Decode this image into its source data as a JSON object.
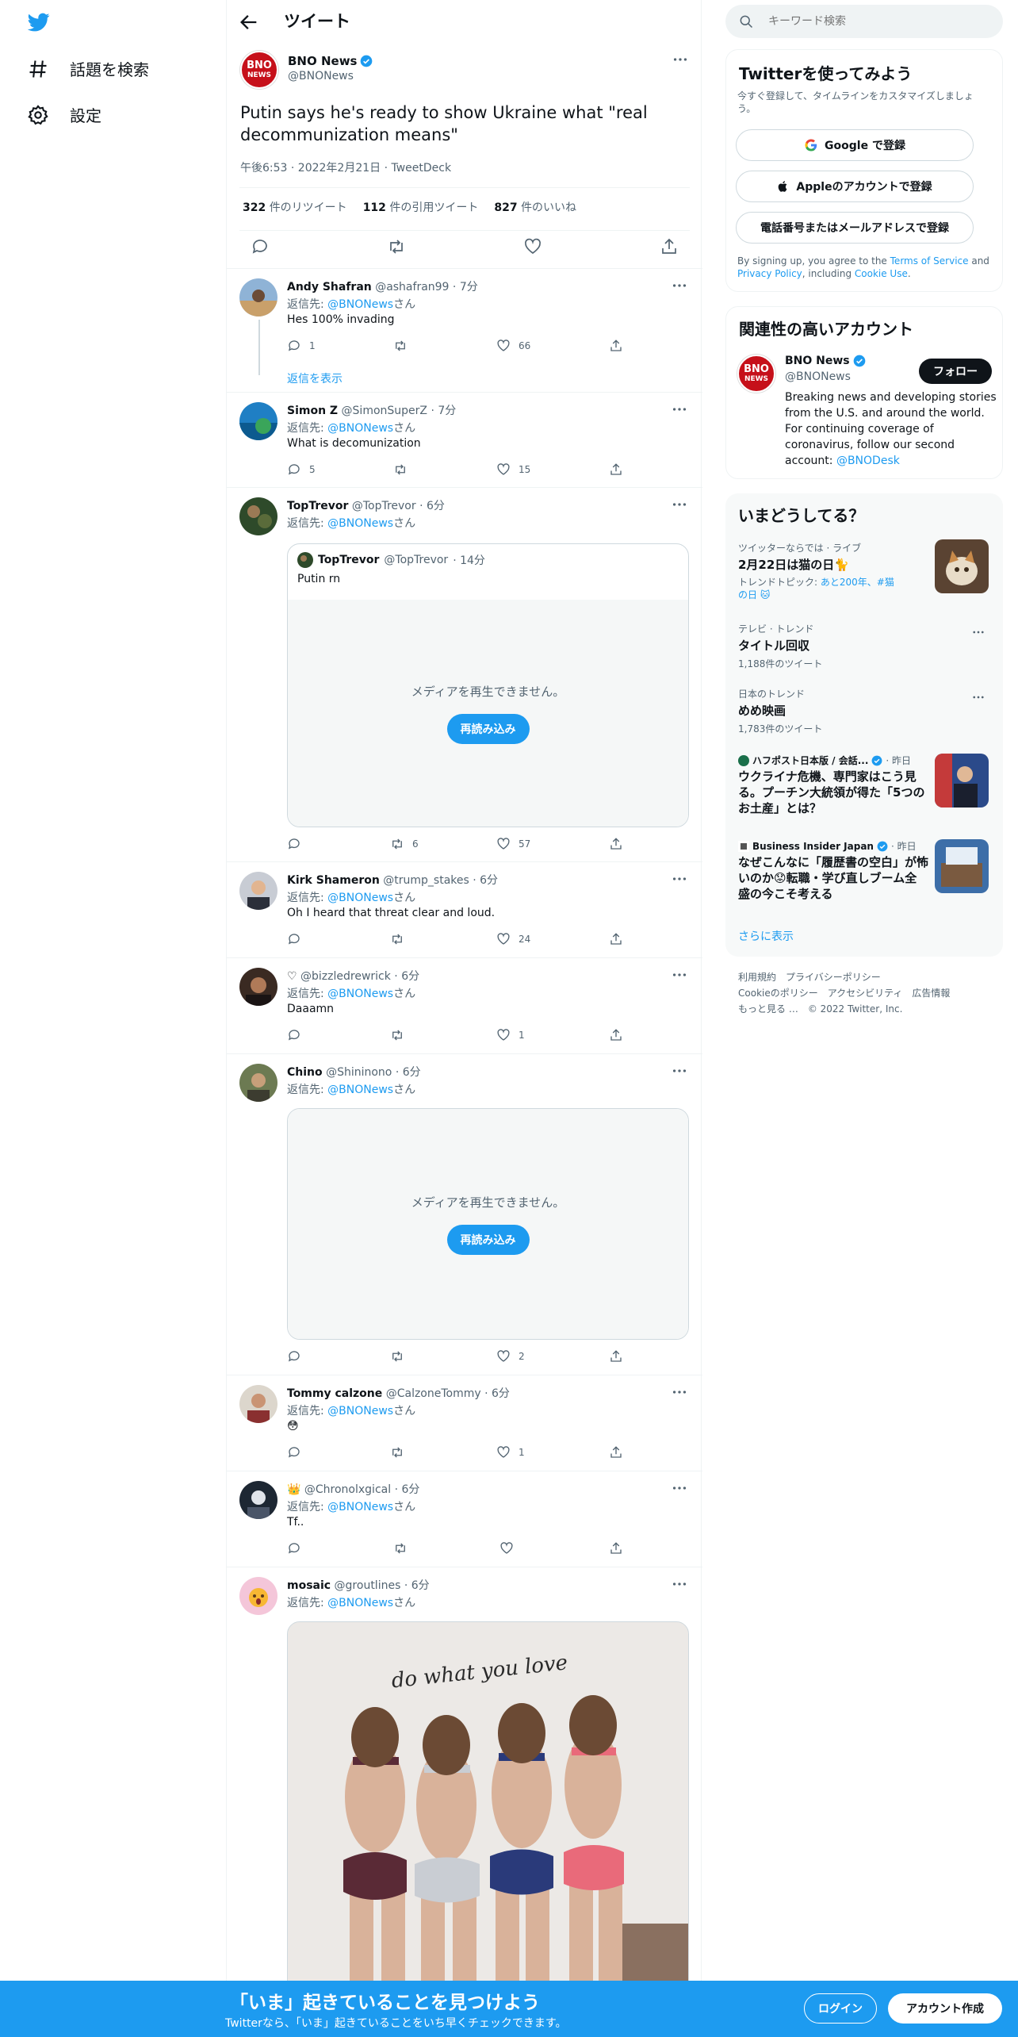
{
  "nav": {
    "explore_label": "話題を検索",
    "settings_label": "設定"
  },
  "header": {
    "title": "ツイート"
  },
  "main_tweet": {
    "name": "BNO News",
    "handle": "@BNONews",
    "avatar_text_top": "BNO",
    "avatar_text_bottom": "NEWS",
    "text": "Putin says he's ready to show Ukraine what \"real decommunization means\"",
    "meta": "午後6:53 · 2022年2月21日 · TweetDeck",
    "retweets_count": "322",
    "retweets_label": "件のリツイート",
    "quotes_count": "112",
    "quotes_label": "件の引用ツイート",
    "likes_count": "827",
    "likes_label": "件のいいね"
  },
  "replies": [
    {
      "name": "Andy Shafran",
      "handle": "@ashafran99",
      "time": "· 7分",
      "to_prefix": "返信先: ",
      "to_link": "@BNONews",
      "to_suffix": "さん",
      "text": "Hes 100% invading",
      "reply_count": "1",
      "retweet_count": "",
      "like_count": "66",
      "show_replies": "返信を表示"
    },
    {
      "name": "Simon Z",
      "handle": "@SimonSuperZ",
      "time": "· 7分",
      "to_prefix": "返信先: ",
      "to_link": "@BNONews",
      "to_suffix": "さん",
      "text": "What is decomunization",
      "reply_count": "5",
      "retweet_count": "",
      "like_count": "15"
    },
    {
      "name": "TopTrevor",
      "handle": "@TopTrevor",
      "time": "· 6分",
      "to_prefix": "返信先: ",
      "to_link": "@BNONews",
      "to_suffix": "さん",
      "quoted_name": "TopTrevor",
      "quoted_handle": "@TopTrevor",
      "quoted_time": "· 14分",
      "quoted_text": "Putin rn",
      "media_msg": "メディアを再生できません。",
      "reload": "再読み込み",
      "reply_count": "",
      "retweet_count": "6",
      "like_count": "57"
    },
    {
      "name": "Kirk Shameron",
      "handle": "@trump_stakes",
      "time": "· 6分",
      "to_prefix": "返信先: ",
      "to_link": "@BNONews",
      "to_suffix": "さん",
      "text": "Oh I heard that threat clear and loud.",
      "reply_count": "",
      "retweet_count": "",
      "like_count": "24"
    },
    {
      "name": "♡",
      "handle": "@bizzledrewrick",
      "time": "· 6分",
      "to_prefix": "返信先: ",
      "to_link": "@BNONews",
      "to_suffix": "さん",
      "text": "Daaamn",
      "reply_count": "",
      "retweet_count": "",
      "like_count": "1"
    },
    {
      "name": "Chino",
      "handle": "@Shininono",
      "time": "· 6分",
      "to_prefix": "返信先: ",
      "to_link": "@BNONews",
      "to_suffix": "さん",
      "media_msg": "メディアを再生できません。",
      "reload": "再読み込み",
      "reply_count": "",
      "retweet_count": "",
      "like_count": "2"
    },
    {
      "name": "Tommy calzone",
      "handle": "@CalzoneTommy",
      "time": "· 6分",
      "to_prefix": "返信先: ",
      "to_link": "@BNONews",
      "to_suffix": "さん",
      "text": "😳",
      "reply_count": "",
      "retweet_count": "",
      "like_count": "1"
    },
    {
      "name": "👑",
      "handle": "@Chronolxgical",
      "time": "· 6分",
      "to_prefix": "返信先: ",
      "to_link": "@BNONews",
      "to_suffix": "さん",
      "text": "Tf..",
      "reply_count": "",
      "retweet_count": "",
      "like_count": ""
    },
    {
      "name": "mosaic",
      "handle": "@groutlines",
      "time": "· 6分",
      "to_prefix": "返信先: ",
      "to_link": "@BNONews",
      "to_suffix": "さん",
      "image_caption": "do what you love"
    }
  ],
  "search": {
    "placeholder": "キーワード検索"
  },
  "signup_card": {
    "title": "Twitterを使ってみよう",
    "subtitle": "今すぐ登録して、タイムラインをカスタマイズしましょう。",
    "google": "Google で登録",
    "apple": "Appleのアカウントで登録",
    "phone": "電話番号またはメールアドレスで登録",
    "terms_prefix": "By signing up, you agree to the ",
    "terms_link": "Terms of Service",
    "terms_and": " and ",
    "privacy_link": "Privacy Policy",
    "terms_including": ", including ",
    "cookie_link": "Cookie Use",
    "terms_end": "."
  },
  "related": {
    "title": "関連性の高いアカウント",
    "name": "BNO News",
    "handle": "@BNONews",
    "follow": "フォロー",
    "bio": "Breaking news and developing stories from the U.S. and around the world. For continuing coverage of coronavirus, follow our second account: ",
    "bio_link": "@BNODesk"
  },
  "trends": {
    "title": "いまどうしてる？",
    "items": [
      {
        "context": "ツイッターならでは · ライブ",
        "title": "2月22日は猫の日🐈",
        "extra_prefix": "トレンドトピック: ",
        "extra": "あと200年、#猫の日 🐱"
      },
      {
        "context": "テレビ · トレンド",
        "title": "タイトル回収",
        "count": "1,188件のツイート"
      },
      {
        "context": "日本のトレンド",
        "title": "めめ映画",
        "count": "1,783件のツイート"
      },
      {
        "source": "ハフポスト日本版 / 会話...",
        "time": "· 昨日",
        "title": "ウクライナ危機、専門家はこう見る。プーチン大統領が得た「5つのお土産」とは？"
      },
      {
        "source": "Business Insider Japan",
        "time": "· 昨日",
        "title": "なぜこんなに「履歴書の空白」が怖いのか😟転職・学び直しブーム全盛の今こそ考える"
      }
    ],
    "show_more": "さらに表示"
  },
  "footer": {
    "line1": "利用規約　プライバシーポリシー",
    "line2": "Cookieのポリシー　アクセシビリティ　広告情報",
    "line3": "もっと見る …　© 2022 Twitter, Inc."
  },
  "bottom_bar": {
    "title": "「いま」起きていることを見つけよう",
    "subtitle": "Twitterなら、「いま」起きていることをいち早くチェックできます。",
    "login": "ログイン",
    "signup": "アカウント作成"
  },
  "colors": {
    "accent": "#1d9bf0",
    "text": "#0f1419",
    "secondary": "#536471",
    "bno_red": "#c6101a"
  }
}
